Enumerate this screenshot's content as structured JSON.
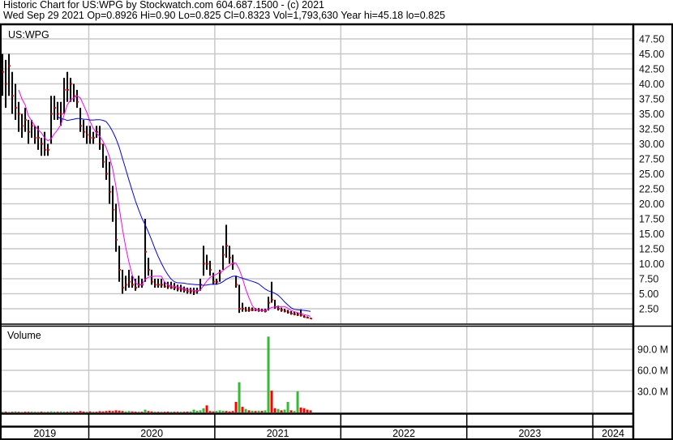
{
  "header": {
    "title": "Historic Chart for US:WPG by Stockwatch.com 604.687.1500 - (c) 2021",
    "quote": "Wed Sep 29 2021   Op=0.8926  Hi=0.90  Lo=0.825  Cl=0.8323  Vol=1,793,630  Year hi=45.18  lo=0.825"
  },
  "colors": {
    "bar": "#000000",
    "close_tick": "#ff0000",
    "ma_short": "#ff00ff",
    "ma_long": "#0000ff",
    "vol_up": "#33bb33",
    "vol_down": "#ff0000",
    "grid": "#c8c8c8"
  },
  "chart_data": {
    "type": "line",
    "title": "US:WPG",
    "volume_label": "Volume",
    "x_start_year": 2019.315,
    "x_step_years": 0.02574,
    "ylim": [
      0,
      49.8
    ],
    "y_ticks": [
      "47.50",
      "45.00",
      "42.50",
      "40.00",
      "37.50",
      "35.00",
      "32.50",
      "30.00",
      "27.50",
      "25.00",
      "22.50",
      "20.00",
      "17.50",
      "15.00",
      "12.50",
      "10.00",
      "7.50",
      "5.00",
      "2.50"
    ],
    "volume_ticks": [
      {
        "value": 90,
        "label": "90.0 M"
      },
      {
        "value": 60,
        "label": "60.0 M"
      },
      {
        "value": 30,
        "label": "30.0 M"
      }
    ],
    "x_labels": [
      "2019",
      "2020",
      "2021",
      "2022",
      "2023",
      "2024"
    ],
    "ma_periods": [
      6,
      18
    ],
    "bars_hlc": [
      [
        45,
        38,
        42
      ],
      [
        44,
        36,
        40
      ],
      [
        45,
        38,
        43
      ],
      [
        42,
        35,
        38
      ],
      [
        40,
        34,
        36
      ],
      [
        37,
        32,
        35
      ],
      [
        35,
        31,
        33
      ],
      [
        36,
        32,
        34
      ],
      [
        34,
        30,
        32
      ],
      [
        34,
        31,
        33
      ],
      [
        33,
        30,
        31
      ],
      [
        33,
        29,
        31
      ],
      [
        31,
        28,
        30
      ],
      [
        32,
        28,
        29
      ],
      [
        30,
        28,
        29
      ],
      [
        38,
        30,
        35
      ],
      [
        38,
        34,
        36
      ],
      [
        37,
        34,
        35
      ],
      [
        37,
        33,
        35
      ],
      [
        41,
        35,
        39
      ],
      [
        42,
        37,
        39
      ],
      [
        41,
        37,
        40
      ],
      [
        40,
        37,
        38
      ],
      [
        39,
        36,
        37
      ],
      [
        36,
        32,
        33
      ],
      [
        34,
        31,
        32
      ],
      [
        33,
        30,
        31.5
      ],
      [
        33,
        30,
        31
      ],
      [
        32,
        30,
        31
      ],
      [
        33,
        31,
        32
      ],
      [
        33,
        29,
        30
      ],
      [
        30,
        26,
        27
      ],
      [
        28,
        24,
        25
      ],
      [
        27,
        20,
        22
      ],
      [
        23,
        17,
        19
      ],
      [
        20,
        12,
        14
      ],
      [
        13,
        7,
        9
      ],
      [
        9,
        5,
        6
      ],
      [
        8,
        5.5,
        6.5
      ],
      [
        9,
        6,
        7
      ],
      [
        8,
        6,
        6.5
      ],
      [
        7.5,
        5.5,
        6
      ],
      [
        8,
        6,
        6.5
      ],
      [
        7.5,
        6,
        6.5
      ],
      [
        17.5,
        7,
        12
      ],
      [
        11,
        8,
        9
      ],
      [
        9,
        6.5,
        7
      ],
      [
        7.5,
        6,
        6.5
      ],
      [
        7.5,
        6,
        6.5
      ],
      [
        7.5,
        6,
        6.5
      ],
      [
        7,
        6,
        6.2
      ],
      [
        7,
        5.8,
        6.2
      ],
      [
        7,
        5.8,
        6
      ],
      [
        6.8,
        5.6,
        6
      ],
      [
        6.5,
        5.4,
        5.8
      ],
      [
        6.5,
        5.3,
        5.7
      ],
      [
        6.2,
        5.2,
        5.6
      ],
      [
        6,
        5,
        5.4
      ],
      [
        6,
        5,
        5.4
      ],
      [
        6,
        4.8,
        5.3
      ],
      [
        6,
        5,
        5.5
      ],
      [
        7.5,
        5.5,
        6.5
      ],
      [
        13,
        8,
        10
      ],
      [
        11.5,
        9,
        10
      ],
      [
        10.5,
        8,
        9
      ],
      [
        8.5,
        6.5,
        7
      ],
      [
        7.5,
        6.5,
        7
      ],
      [
        9,
        7,
        8.5
      ],
      [
        13,
        9,
        11.5
      ],
      [
        16.5,
        11,
        13
      ],
      [
        13,
        10,
        11
      ],
      [
        11.5,
        9,
        10
      ],
      [
        8,
        6,
        6.5
      ],
      [
        6.5,
        1.8,
        2.5
      ],
      [
        3.5,
        2,
        2.5
      ],
      [
        2.8,
        2,
        2.2
      ],
      [
        2.8,
        2,
        2.3
      ],
      [
        2.7,
        2.1,
        2.3
      ],
      [
        2.6,
        2.1,
        2.3
      ],
      [
        2.6,
        2,
        2.2
      ],
      [
        2.5,
        2,
        2.2
      ],
      [
        2.5,
        1.9,
        2.1
      ],
      [
        4.5,
        2.2,
        3.5
      ],
      [
        7,
        3.5,
        4
      ],
      [
        4,
        2.5,
        2.8
      ],
      [
        3,
        2.2,
        2.5
      ],
      [
        2.7,
        2,
        2.3
      ],
      [
        2.5,
        1.9,
        2.1
      ],
      [
        2.3,
        1.7,
        1.9
      ],
      [
        2.1,
        1.5,
        1.7
      ],
      [
        2,
        1.4,
        1.6
      ],
      [
        1.9,
        1.3,
        1.5
      ],
      [
        2.4,
        1.2,
        1.4
      ],
      [
        1.4,
        1,
        1.1
      ],
      [
        1.2,
        0.9,
        1.0
      ],
      [
        1.0,
        0.82,
        0.85
      ]
    ],
    "volume_m": [
      1,
      1.2,
      0.8,
      1,
      1.5,
      1,
      0.9,
      1.1,
      1,
      1.3,
      0.8,
      1,
      1.2,
      1,
      0.9,
      1.5,
      1.2,
      1,
      1.4,
      1.1,
      1,
      1.6,
      1.2,
      1,
      2,
      1.3,
      1.1,
      1.5,
      1.2,
      1,
      1.8,
      1.5,
      2,
      2.5,
      2,
      3,
      2.5,
      2,
      1.5,
      2,
      1.5,
      1.2,
      1.3,
      1.1,
      4,
      2,
      1.5,
      1.2,
      1,
      1.1,
      1,
      1.2,
      1.1,
      1,
      1,
      1.1,
      1,
      1.2,
      1.5,
      4,
      2.5,
      3,
      6,
      10,
      2,
      1.5,
      2,
      3,
      2.5,
      2,
      1.5,
      2,
      15,
      43,
      8,
      5,
      3,
      2.5,
      2,
      2.5,
      2.2,
      3,
      108,
      31,
      6,
      5,
      3,
      4,
      15,
      3,
      2,
      30,
      7,
      6,
      4,
      3
    ],
    "volume_up": [
      1,
      0,
      1,
      0,
      1,
      0,
      1,
      0,
      0,
      1,
      0,
      1,
      0,
      1,
      0,
      1,
      1,
      0,
      1,
      1,
      0,
      1,
      0,
      0,
      0,
      0,
      1,
      0,
      1,
      0,
      0,
      0,
      0,
      0,
      0,
      0,
      0,
      0,
      1,
      1,
      0,
      0,
      1,
      0,
      1,
      0,
      0,
      1,
      0,
      1,
      0,
      0,
      1,
      0,
      0,
      1,
      0,
      0,
      1,
      1,
      1,
      1,
      1,
      0,
      0,
      0,
      1,
      1,
      1,
      0,
      0,
      0,
      0,
      1,
      0,
      1,
      0,
      1,
      0,
      1,
      0,
      1,
      1,
      0,
      0,
      1,
      0,
      1,
      1,
      0,
      1,
      1,
      0,
      0,
      0
    ]
  }
}
